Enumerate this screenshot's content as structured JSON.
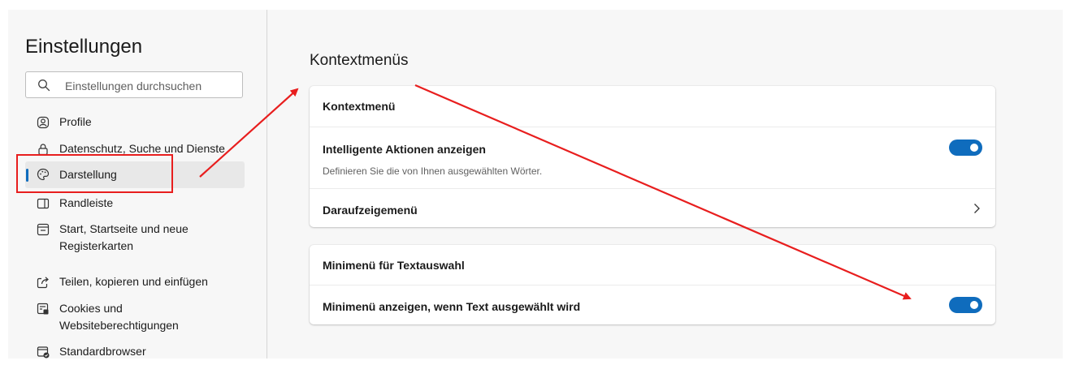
{
  "sidebar": {
    "title": "Einstellungen",
    "search_placeholder": "Einstellungen durchsuchen",
    "items": [
      {
        "label": "Profile",
        "icon": "profile-icon"
      },
      {
        "label": "Datenschutz, Suche und Dienste",
        "icon": "lock-icon"
      },
      {
        "label": "Darstellung",
        "icon": "palette-icon",
        "active": true
      },
      {
        "label": "Randleiste",
        "icon": "sidebar-icon"
      },
      {
        "label": "Start, Startseite und neue Registerkarten",
        "icon": "home-tabs-icon"
      },
      {
        "label": "Teilen, kopieren und einfügen",
        "icon": "share-icon"
      },
      {
        "label": "Cookies und Websiteberechtigungen",
        "icon": "cookies-icon"
      },
      {
        "label": "Standardbrowser",
        "icon": "default-browser-icon"
      }
    ]
  },
  "main": {
    "title": "Kontextmenüs",
    "card1": {
      "header": "Kontextmenü",
      "smart_actions": {
        "label": "Intelligente Aktionen anzeigen",
        "description": "Definieren Sie die von Ihnen ausgewählten Wörter.",
        "enabled": true
      },
      "hover_menu": {
        "label": "Daraufzeigemenü"
      }
    },
    "card2": {
      "header": "Minimenü für Textauswahl",
      "mini_menu": {
        "label": "Minimenü anzeigen, wenn Text ausgewählt wird",
        "enabled": true
      }
    }
  },
  "colors": {
    "accent": "#0f6cbd",
    "annotation": "#e81e1e",
    "background": "#f7f7f7"
  }
}
